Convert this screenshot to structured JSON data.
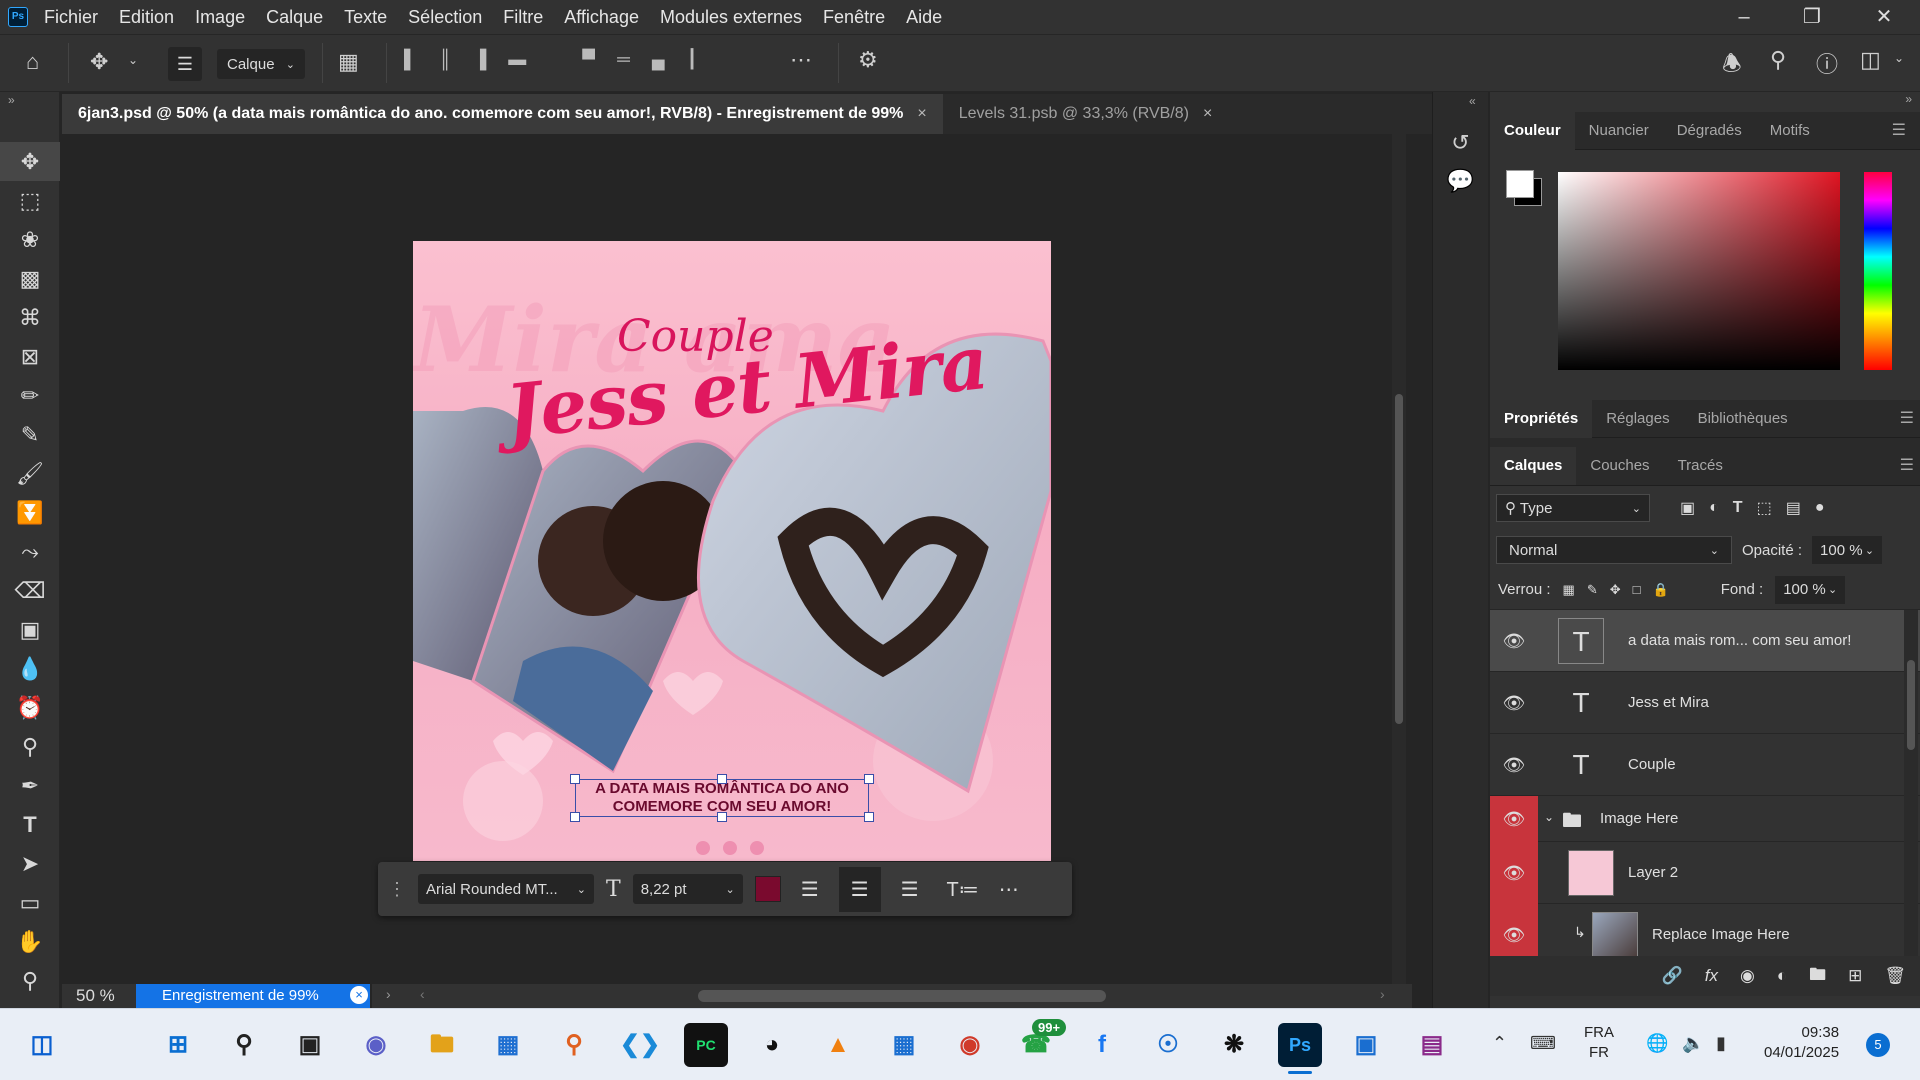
{
  "app": {
    "logo": "Ps"
  },
  "menu": [
    "Fichier",
    "Edition",
    "Image",
    "Calque",
    "Texte",
    "Sélection",
    "Filtre",
    "Affichage",
    "Modules externes",
    "Fenêtre",
    "Aide"
  ],
  "options": {
    "layer_select": "Calque"
  },
  "tabs": [
    {
      "label": "6jan3.psd @ 50% (a data mais romântica do ano. comemore com seu amor!, RVB/8) - Enregistrement de 99%",
      "active": true
    },
    {
      "label": "Levels 31.psb @ 33,3% (RVB/8)",
      "active": false
    }
  ],
  "canvas": {
    "title_small": "Couple",
    "title_big": "Jess et Mira",
    "caption_line1": "A DATA MAIS ROMÂNTICA DO ANO",
    "caption_line2": "COMEMORE COM SEU AMOR!"
  },
  "text_toolbar": {
    "font": "Arial Rounded MT...",
    "size": "8,22 pt",
    "color": "#7a0a2e"
  },
  "status": {
    "zoom": "50 %",
    "progress_label": "Enregistrement de 99%",
    "progress": 0.99
  },
  "color_panel": {
    "tabs": [
      "Couleur",
      "Nuancier",
      "Dégradés",
      "Motifs"
    ]
  },
  "props_panel": {
    "tabs": [
      "Propriétés",
      "Réglages",
      "Bibliothèques"
    ]
  },
  "layers_panel": {
    "tabs": [
      "Calques",
      "Couches",
      "Tracés"
    ],
    "filter": "Type",
    "blend_mode": "Normal",
    "opacity_label": "Opacité :",
    "opacity": "100 %",
    "lock_label": "Verrou :",
    "fill_label": "Fond :",
    "fill": "100 %",
    "layers": [
      {
        "name": "a data mais rom... com seu amor!",
        "kind": "text",
        "selected": true
      },
      {
        "name": "Jess et Mira",
        "kind": "text"
      },
      {
        "name": "Couple",
        "kind": "text"
      },
      {
        "name": "Image Here",
        "kind": "group"
      },
      {
        "name": "Layer 2",
        "kind": "pixel"
      },
      {
        "name": "Replace Image Here",
        "kind": "smart"
      }
    ]
  },
  "taskbar": {
    "lang_top": "FRA",
    "lang_bottom": "FR",
    "time": "09:38",
    "date": "04/01/2025",
    "whatsapp_badge": "99+",
    "notif_count": "5"
  },
  "colors": {
    "accent": "#31a8ff",
    "pink": "#e0185f",
    "layer_red": "#c8343c"
  }
}
